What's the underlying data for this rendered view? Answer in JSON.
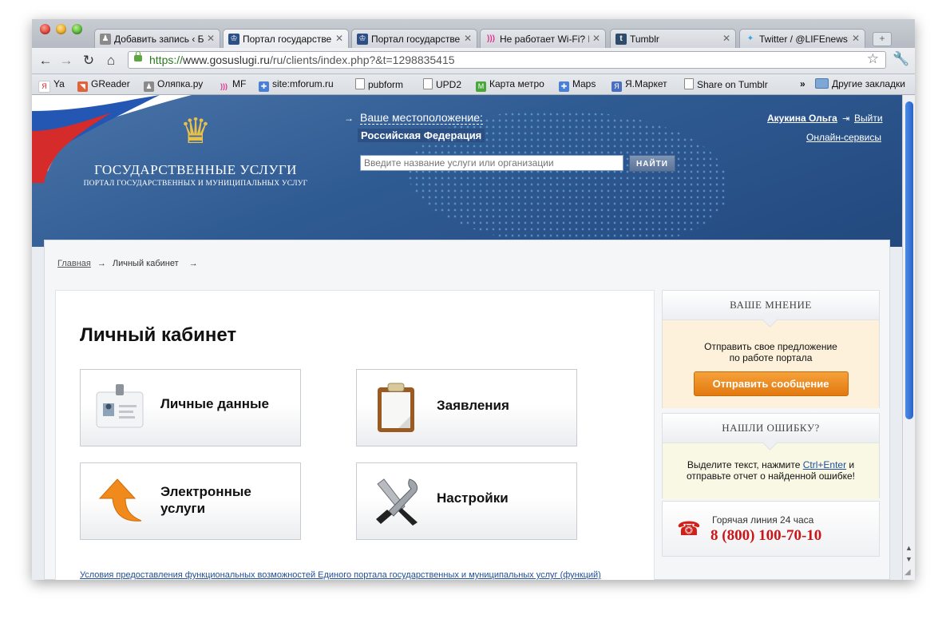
{
  "browser": {
    "tabs": [
      {
        "label": "Добавить запись ‹ Бл",
        "active": false,
        "icon": "user-silhouette-icon",
        "color": "#8a8a8a"
      },
      {
        "label": "Портал государствен",
        "active": true,
        "icon": "coat-of-arms-icon",
        "color": "#2c4f86"
      },
      {
        "label": "Портал государствен",
        "active": false,
        "icon": "coat-of-arms-icon",
        "color": "#2c4f86"
      },
      {
        "label": "Не работает Wi-Fi? П",
        "active": false,
        "icon": "wifi-icon",
        "color": "#e0328a"
      },
      {
        "label": "Tumblr",
        "active": false,
        "icon": "tumblr-icon",
        "color": "#2f4b6b"
      },
      {
        "label": "Twitter / @LIFEnews:",
        "active": false,
        "icon": "twitter-bird-icon",
        "color": "#2aa4e8"
      }
    ],
    "new_tab": "+",
    "close_glyph": "✕",
    "url": {
      "scheme": "https://",
      "host": "www.gosuslugi.ru",
      "path": "/ru/clients/index.php?&t=1298835415"
    },
    "bookmarks": [
      {
        "label": "Ya",
        "icon": "yandex-icon",
        "color": "#d72b2b"
      },
      {
        "label": "GReader",
        "icon": "greader-icon",
        "color": "#e0623a"
      },
      {
        "label": "Оляпка.ру",
        "icon": "user-silhouette-icon",
        "color": "#8a8a8a"
      },
      {
        "label": "MF",
        "icon": "wifi-icon",
        "color": "#e0328a"
      },
      {
        "label": "site:mforum.ru",
        "icon": "google-icon",
        "color": "#4a7fd6"
      },
      {
        "label": "pubform",
        "icon": "page-icon",
        "color": "#ffffff"
      },
      {
        "label": "UPD2",
        "icon": "page-icon",
        "color": "#ffffff"
      },
      {
        "label": "Карта метро",
        "icon": "metro-icon",
        "color": "#4aa83a"
      },
      {
        "label": "Maps",
        "icon": "google-icon",
        "color": "#4a7fd6"
      },
      {
        "label": "Я.Маркет",
        "icon": "market-icon",
        "color": "#4a6fc0"
      },
      {
        "label": "Share on Tumblr",
        "icon": "page-icon",
        "color": "#ffffff"
      }
    ],
    "bookmarks_overflow": "»",
    "other_bookmarks": "Другие закладки"
  },
  "header": {
    "title": "ГОСУДАРСТВЕННЫЕ УСЛУГИ",
    "subtitle": "ПОРТАЛ ГОСУДАРСТВЕННЫХ И МУНИЦИПАЛЬНЫХ УСЛУГ",
    "location_label": "Ваше местоположение:",
    "location_value": "Российская Федерация",
    "search_placeholder": "Введите название услуги или организации",
    "search_button": "НАЙТИ",
    "user_name": "Акукина Ольга",
    "logout": "Выйти",
    "online_services": "Онлайн-сервисы"
  },
  "breadcrumb": {
    "home": "Главная",
    "separator": "→",
    "current": "Личный кабинет"
  },
  "main": {
    "title": "Личный кабинет",
    "tiles": [
      {
        "label": "Личные данные",
        "icon": "id-badge-icon"
      },
      {
        "label": "Заявления",
        "icon": "clipboard-icon"
      },
      {
        "label": "Электронные услуги",
        "icon": "orange-arrow-icon"
      },
      {
        "label": "Настройки",
        "icon": "tools-icon"
      }
    ],
    "footer_link": "Условия предоставления функциональных возможностей Единого портала государственных и муниципальных услуг (функций)"
  },
  "sidebar": {
    "opinion": {
      "title": "ВАШЕ МНЕНИЕ",
      "text_line1": "Отправить свое предложение",
      "text_line2": "по работе портала",
      "button": "Отправить сообщение"
    },
    "error": {
      "title": "НАШЛИ ОШИБКУ?",
      "text_before": "Выделите текст, нажмите ",
      "shortcut": "Ctrl+Enter",
      "text_after": " и",
      "text_line2": "отправьте отчет о найденной ошибке!"
    },
    "hotline": {
      "label": "Горячая линия 24 часа",
      "number": "8 (800) 100-70-10"
    }
  },
  "colors": {
    "header_blue": "#2f5b93",
    "accent_orange": "#e2790f",
    "hotline_red": "#c8171b",
    "link_blue": "#1f4f9a"
  }
}
